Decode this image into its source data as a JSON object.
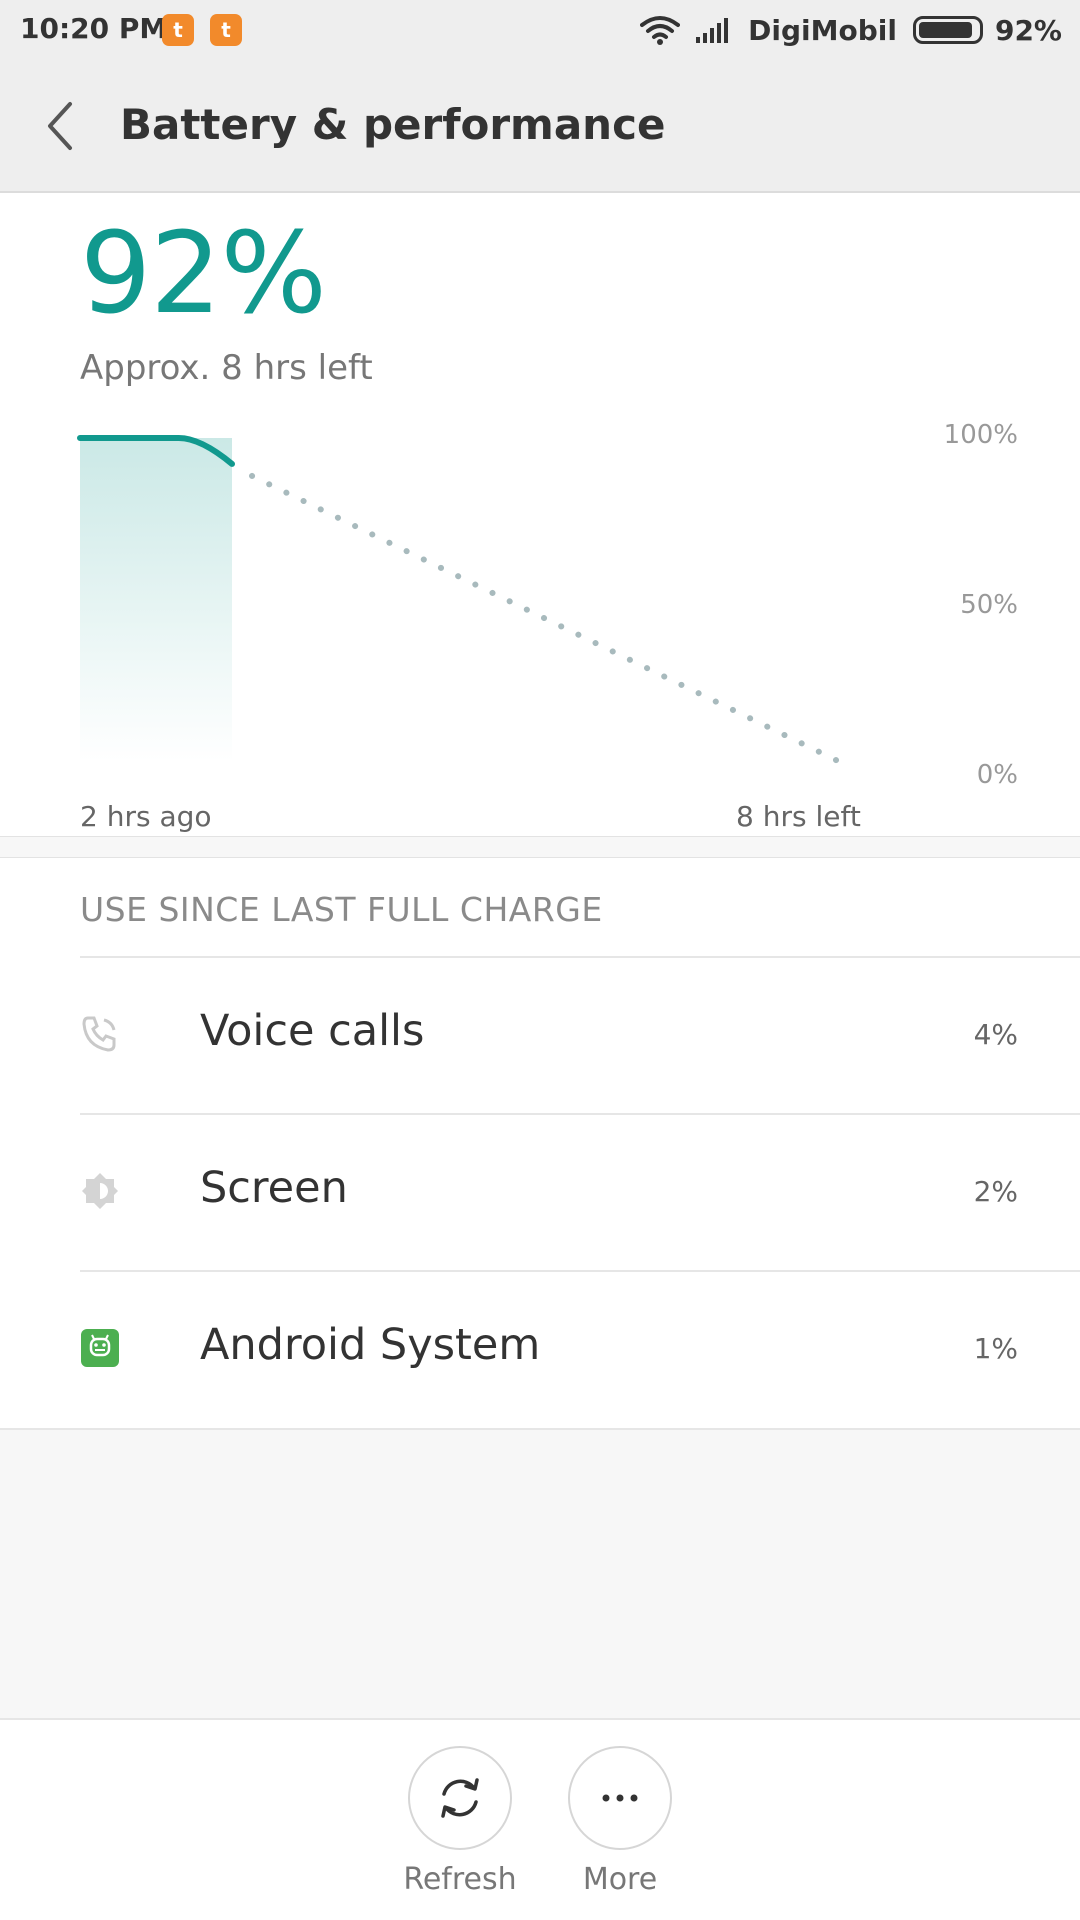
{
  "status_bar": {
    "time": "10:20 PM",
    "notif_glyph": "t",
    "carrier": "DigiMobil",
    "battery_percent": "92%",
    "battery_level": 0.92
  },
  "app_bar": {
    "title": "Battery & performance"
  },
  "battery": {
    "percent": "92%",
    "remaining": "Approx. 8 hrs left"
  },
  "chart_data": {
    "type": "line",
    "y_ticks": [
      "100%",
      "50%",
      "0%"
    ],
    "x_labels": [
      "2 hrs ago",
      "8 hrs left"
    ],
    "ylim": [
      0,
      100
    ],
    "grid": false,
    "series": [
      {
        "values": [
          {
            "x": -2,
            "y": 100
          },
          {
            "x": -0.7,
            "y": 100
          },
          {
            "x": 0,
            "y": 92
          }
        ]
      },
      {
        "values": [
          {
            "x": 0,
            "y": 92
          },
          {
            "x": 8,
            "y": 0
          }
        ]
      }
    ],
    "x_range": [
      -2,
      8
    ]
  },
  "usage": {
    "header": "USE SINCE LAST FULL CHARGE",
    "items": [
      {
        "label": "Voice calls",
        "percent": "4%",
        "icon": "phone-call-icon"
      },
      {
        "label": "Screen",
        "percent": "2%",
        "icon": "brightness-icon"
      },
      {
        "label": "Android System",
        "percent": "1%",
        "icon": "android-icon"
      }
    ]
  },
  "actions": {
    "refresh": "Refresh",
    "more": "More"
  },
  "colors": {
    "accent": "#11998e",
    "projection": "#a8babd",
    "android_green": "#4caf50"
  }
}
